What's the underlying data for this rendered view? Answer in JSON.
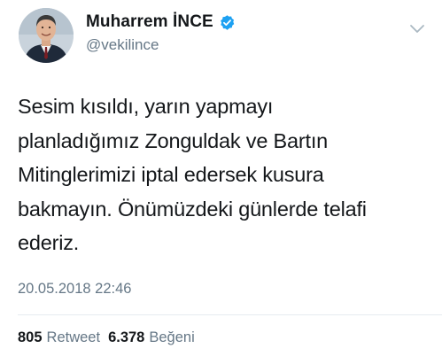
{
  "author": {
    "display_name": "Muharrem İNCE",
    "handle": "@vekilince",
    "verified": true,
    "avatar_icon": "person-avatar"
  },
  "tweet": {
    "text_lines": [
      "Sesim kısıldı, yarın yapmayı",
      "planladığımız Zonguldak ve Bartın",
      "Mitinglerimizi iptal edersek kusura",
      "bakmayın. Önümüzdeki günlerde telafi",
      "ederiz."
    ],
    "timestamp": "20.05.2018 22:46"
  },
  "stats": {
    "retweet_count": "805",
    "retweet_label": "Retweet",
    "like_count": "6.378",
    "like_label": "Beğeni"
  },
  "icons": {
    "verified": "verified-badge-icon",
    "menu": "chevron-down-icon"
  },
  "colors": {
    "verified_blue": "#1da1f2",
    "secondary_text": "#657786",
    "primary_text": "#14171a"
  }
}
